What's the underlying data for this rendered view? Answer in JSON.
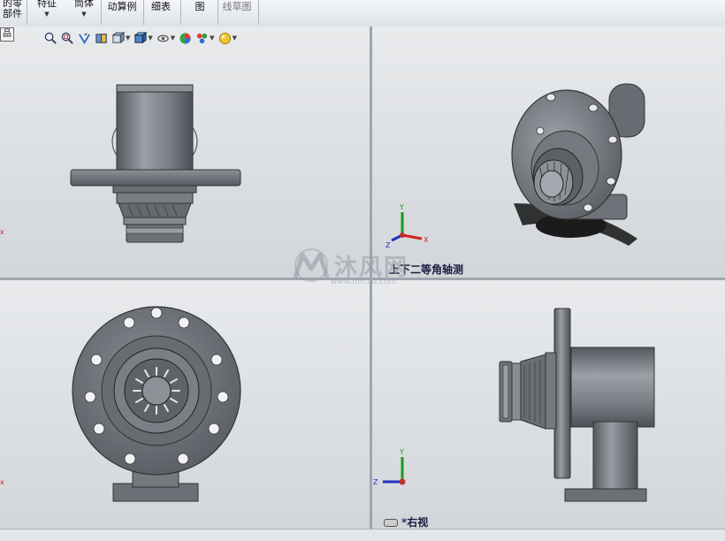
{
  "toolbar": {
    "item1_line1": "的零",
    "item1_line2": "部件",
    "item2_label": "特征",
    "item3_label": "筒体",
    "item4_label": "动算例",
    "item5_label": "细表",
    "item6_label": "图",
    "item7_label": "线草图"
  },
  "feature_tree_tab": "品",
  "heads_up_toolbar": {
    "icons": [
      "zoom-to-fit-icon",
      "zoom-to-area-icon",
      "previous-view-icon",
      "section-view-icon",
      "view-orientation-icon",
      "display-style-icon",
      "hide-show-icon",
      "edit-appearance-icon",
      "apply-scene-icon",
      "view-settings-icon"
    ]
  },
  "viewports": {
    "top_left": {
      "label": ""
    },
    "top_right": {
      "label": "上下二等角轴测"
    },
    "bottom_left": {
      "label": ""
    },
    "bottom_right": {
      "label": "*右视"
    }
  },
  "triad": {
    "x": "X",
    "y": "Y",
    "z": "Z"
  },
  "watermark": {
    "text": "沐风网",
    "url": "www.mfcad.com"
  },
  "colors": {
    "part_gray": "#6e7178",
    "part_light": "#9a9da4",
    "axis_x": "#d42020",
    "axis_y": "#1a9a1a",
    "axis_z": "#2030c0"
  }
}
